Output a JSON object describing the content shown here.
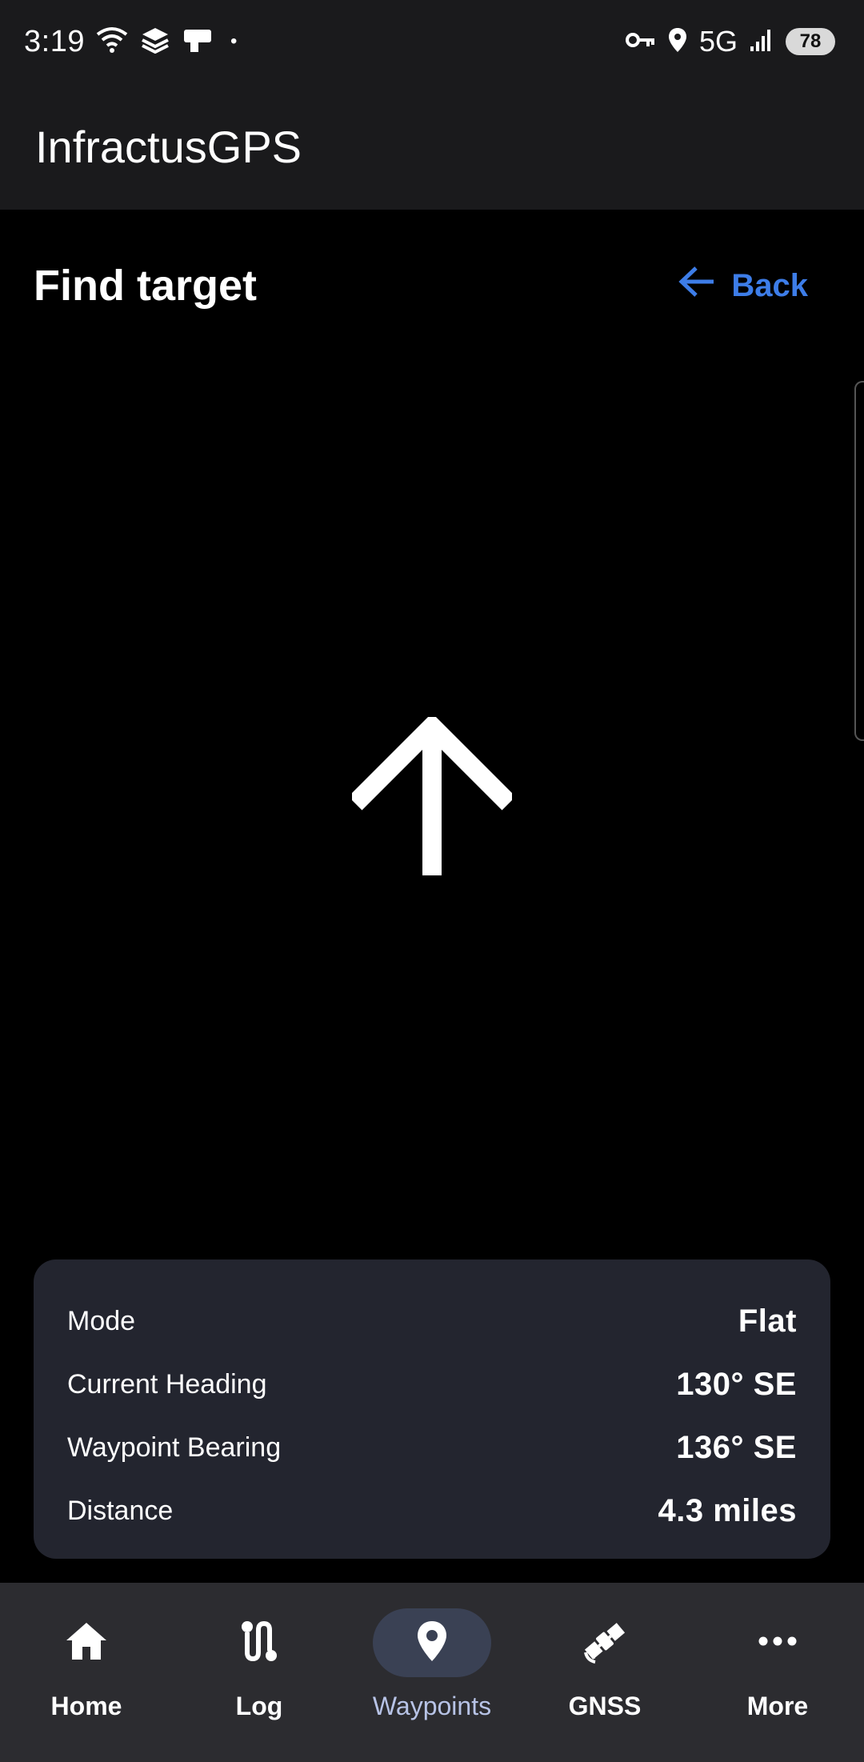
{
  "status_bar": {
    "time": "3:19",
    "network": "5G",
    "battery": "78",
    "dot": "•"
  },
  "app_bar": {
    "title": "InfractusGPS"
  },
  "page": {
    "title": "Find target",
    "back_label": "Back"
  },
  "info": {
    "rows": [
      {
        "label": "Mode",
        "value": "Flat"
      },
      {
        "label": "Current Heading",
        "value": "130° SE"
      },
      {
        "label": "Waypoint Bearing",
        "value": "136° SE"
      },
      {
        "label": "Distance",
        "value": "4.3 miles"
      }
    ]
  },
  "nav": {
    "items": [
      {
        "label": "Home",
        "icon": "home-icon"
      },
      {
        "label": "Log",
        "icon": "route-icon"
      },
      {
        "label": "Waypoints",
        "icon": "location-pin-icon",
        "active": true
      },
      {
        "label": "GNSS",
        "icon": "satellite-icon"
      },
      {
        "label": "More",
        "icon": "more-dots-icon"
      }
    ]
  },
  "colors": {
    "accent": "#3d7de8",
    "card": "#23252f",
    "nav_bg": "#2c2c30",
    "nav_active_pill": "#3a4154"
  }
}
